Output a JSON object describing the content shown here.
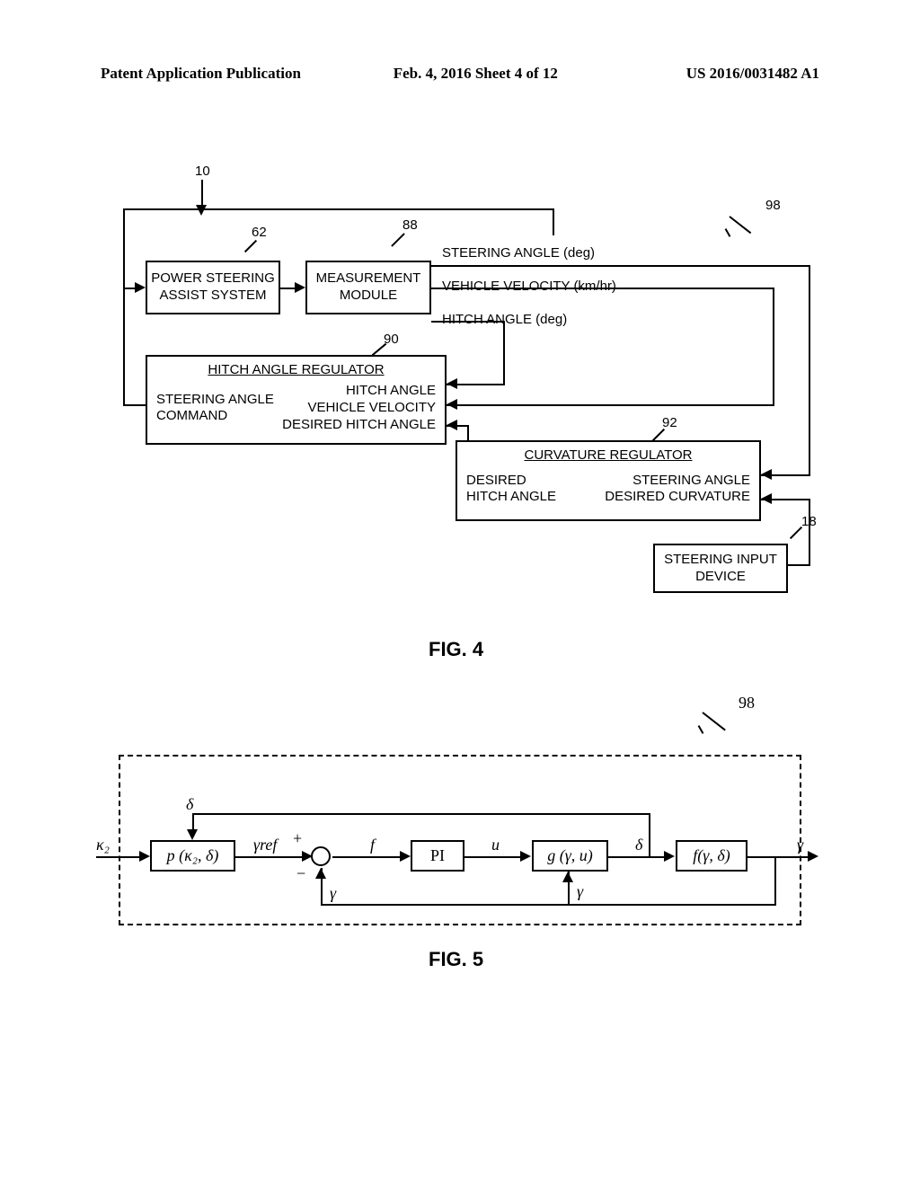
{
  "header": {
    "left": "Patent Application Publication",
    "center": "Feb. 4, 2016  Sheet 4 of 12",
    "right": "US 2016/0031482 A1"
  },
  "fig4": {
    "caption": "FIG. 4",
    "labels": {
      "overall": "98",
      "ten": "10",
      "power_steering": "62",
      "measurement": "88",
      "hitch_reg": "90",
      "curv_reg": "92",
      "steer_input": "18"
    },
    "boxes": {
      "power_steering": [
        "POWER STEERING",
        "ASSIST SYSTEM"
      ],
      "measurement": [
        "MEASUREMENT",
        "MODULE"
      ],
      "hitch_regulator_title": "HITCH ANGLE REGULATOR",
      "hitch_regulator_left": [
        "STEERING ANGLE",
        "COMMAND"
      ],
      "hitch_regulator_right": [
        "HITCH ANGLE",
        "VEHICLE VELOCITY",
        "DESIRED HITCH ANGLE"
      ],
      "curvature_title": "CURVATURE REGULATOR",
      "curvature_left": [
        "DESIRED",
        "HITCH ANGLE"
      ],
      "curvature_right": [
        "STEERING ANGLE",
        "DESIRED CURVATURE"
      ],
      "steering_input": [
        "STEERING INPUT",
        "DEVICE"
      ],
      "meas_out": [
        "STEERING ANGLE (deg)",
        "VEHICLE VELOCITY (km/hr)",
        "HITCH ANGLE (deg)"
      ]
    }
  },
  "fig5": {
    "caption": "FIG. 5",
    "overall": "98",
    "boxes": {
      "p": "p (κ₂, δ)",
      "pi": "PI",
      "g": "g (γ, u)",
      "f": "f(γ, δ)"
    },
    "labels": {
      "k2": "κ₂",
      "delta": "δ",
      "gammaref": "γref",
      "plus": "+",
      "minus": "−",
      "f": "f",
      "u": "u",
      "gamma": "γ"
    }
  }
}
